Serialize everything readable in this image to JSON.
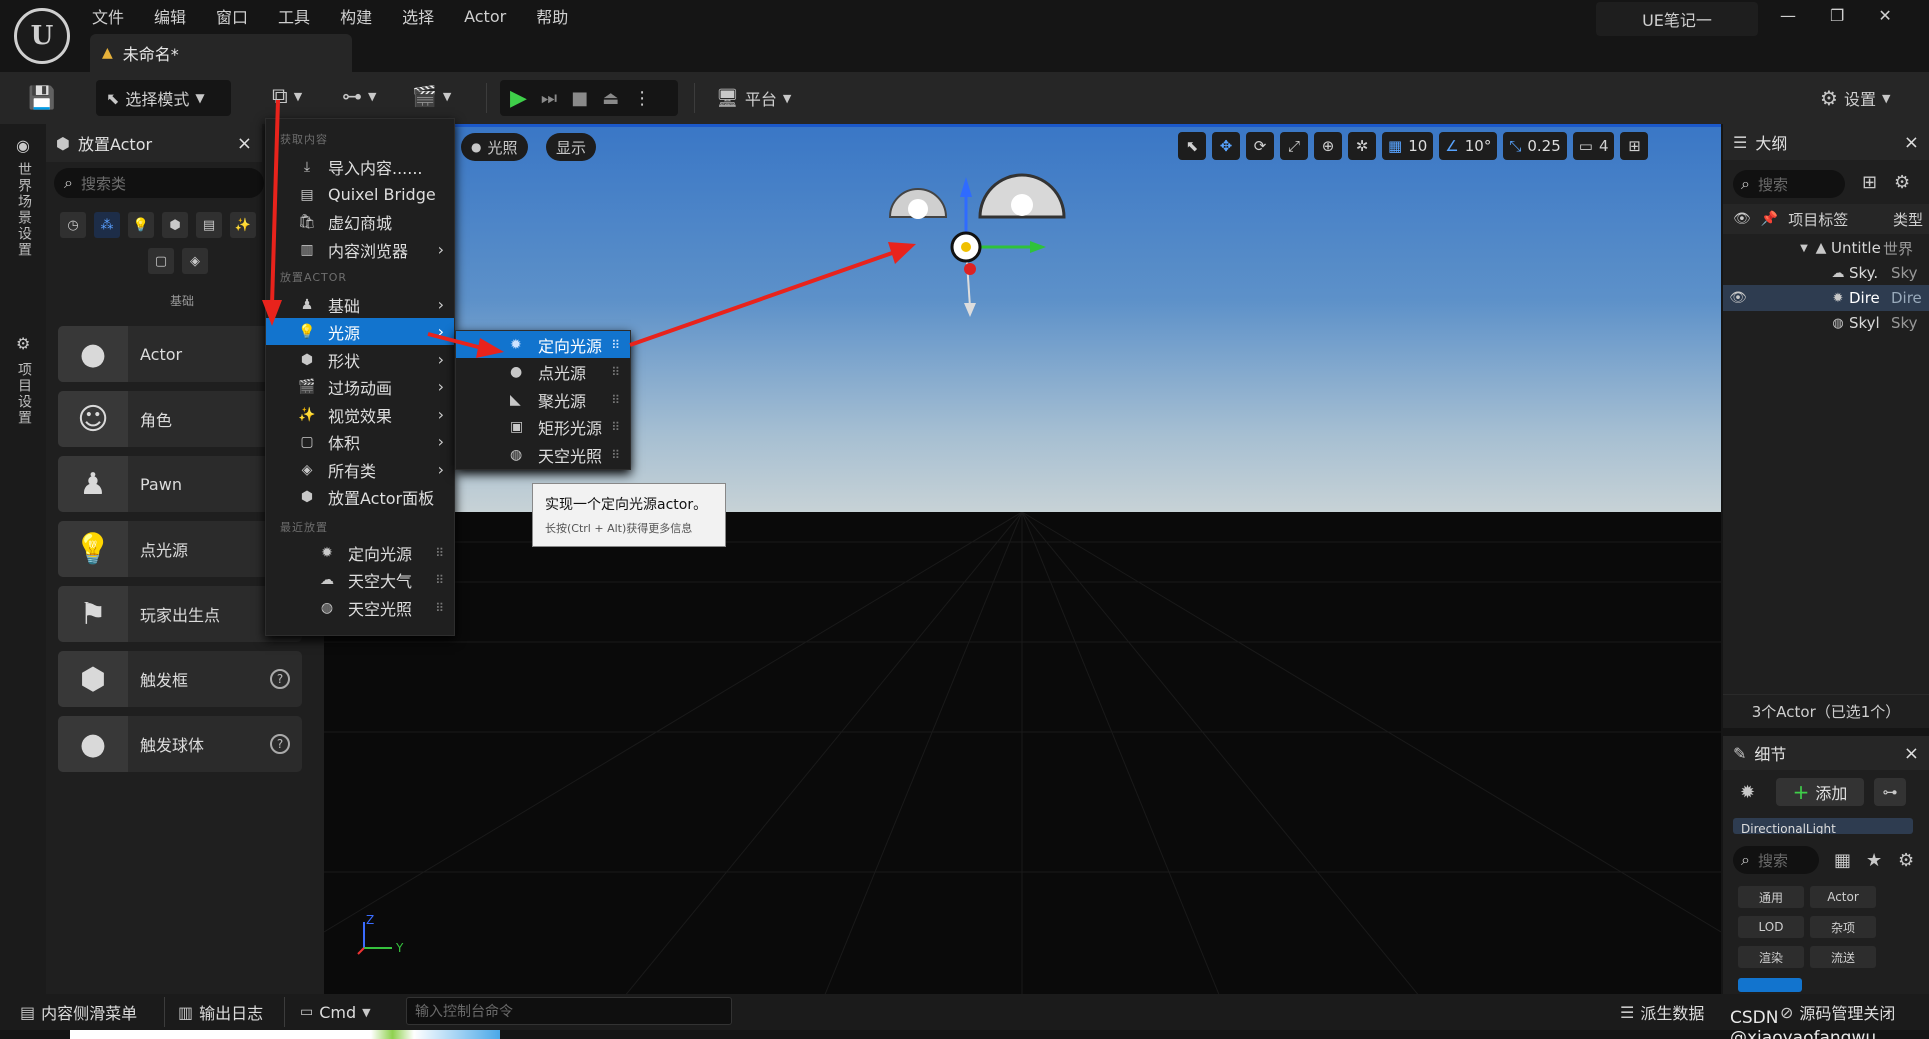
{
  "window": {
    "menu": [
      "文件",
      "编辑",
      "窗口",
      "工具",
      "构建",
      "选择",
      "Actor",
      "帮助"
    ],
    "doc_tab": "未命名*",
    "project": "UE笔记一",
    "controls": [
      "—",
      "❐",
      "✕"
    ]
  },
  "toolbar": {
    "mode": "选择模式",
    "platform": "平台",
    "settings": "设置"
  },
  "left_strip": {
    "world_settings": "世界场景设置",
    "project_settings": "项目设置"
  },
  "place_panel": {
    "title": "放置Actor",
    "close": "×",
    "search_placeholder": "搜索类",
    "category_label": "基础",
    "items": [
      {
        "label": "Actor",
        "icon": "●",
        "help": false
      },
      {
        "label": "角色",
        "icon": "☺",
        "help": false
      },
      {
        "label": "Pawn",
        "icon": "♟",
        "help": false
      },
      {
        "label": "点光源",
        "icon": "💡",
        "help": false
      },
      {
        "label": "玩家出生点",
        "icon": "⚑",
        "help": false
      },
      {
        "label": "触发框",
        "icon": "⬢",
        "help": true
      },
      {
        "label": "触发球体",
        "icon": "●",
        "help": true
      }
    ]
  },
  "viewport": {
    "lighting": "光照",
    "show": "显示",
    "grid": "10",
    "angle": "10°",
    "scale": "0.25",
    "camera": "4",
    "axis_z": "Z",
    "axis_y": "Y"
  },
  "dropdown": {
    "sec_get": "获取内容",
    "get_items": [
      {
        "label": "导入内容......",
        "icon": "⤓",
        "arrow": false
      },
      {
        "label": "Quixel Bridge",
        "icon": "▤",
        "arrow": false
      },
      {
        "label": "虚幻商城",
        "icon": "🛍",
        "arrow": false
      },
      {
        "label": "内容浏览器",
        "icon": "▥",
        "arrow": true
      }
    ],
    "sec_place": "放置ACTOR",
    "place_items": [
      {
        "label": "基础",
        "icon": "♟",
        "arrow": true
      },
      {
        "label": "光源",
        "icon": "💡",
        "arrow": true
      },
      {
        "label": "形状",
        "icon": "⬢",
        "arrow": true
      },
      {
        "label": "过场动画",
        "icon": "🎬",
        "arrow": true
      },
      {
        "label": "视觉效果",
        "icon": "✨",
        "arrow": true
      },
      {
        "label": "体积",
        "icon": "▢",
        "arrow": true
      },
      {
        "label": "所有类",
        "icon": "◈",
        "arrow": true
      },
      {
        "label": "放置Actor面板",
        "icon": "⬢",
        "arrow": false
      }
    ],
    "sec_recent": "最近放置",
    "recent_items": [
      {
        "label": "定向光源",
        "icon": "✹"
      },
      {
        "label": "天空大气",
        "icon": "☁"
      },
      {
        "label": "天空光照",
        "icon": "◍"
      }
    ]
  },
  "light_submenu": [
    {
      "label": "定向光源",
      "icon": "✹"
    },
    {
      "label": "点光源",
      "icon": "●"
    },
    {
      "label": "聚光源",
      "icon": "◣"
    },
    {
      "label": "矩形光源",
      "icon": "▣"
    },
    {
      "label": "天空光照",
      "icon": "◍"
    }
  ],
  "tooltip": {
    "main": "实现一个定向光源actor。",
    "sub": "长按(Ctrl + Alt)获得更多信息"
  },
  "outliner": {
    "title": "大纲",
    "close": "×",
    "search_placeholder": "搜索",
    "col_label": "项目标签",
    "col_type": "类型",
    "rows": [
      {
        "label": "Untitle",
        "type": "世界",
        "indent": 1,
        "selected": false
      },
      {
        "label": "Sky.",
        "type": "Sky",
        "indent": 2,
        "selected": false
      },
      {
        "label": "Dire",
        "type": "Dire",
        "indent": 2,
        "selected": true
      },
      {
        "label": "Skyl",
        "type": "Sky",
        "indent": 2,
        "selected": false
      }
    ],
    "footer": "3个Actor（已选1个）"
  },
  "details": {
    "title": "细节",
    "close": "×",
    "add": "添加",
    "component": "DirectionalLight",
    "search_placeholder": "搜索",
    "chips": [
      "通用",
      "Actor",
      "LOD",
      "杂项",
      "渲染",
      "流送"
    ]
  },
  "statusbar": {
    "content_drawer": "内容侧滑菜单",
    "output_log": "输出日志",
    "cmd": "Cmd",
    "console_placeholder": "输入控制台命令",
    "derived_data": "派生数据",
    "source_control": "源码管理关闭"
  },
  "watermark": "CSDN @xiaoyaofangwu",
  "colors": {
    "accent": "#1274ce",
    "arrow": "#e8231c",
    "viewport_border": "#1b58c9"
  }
}
